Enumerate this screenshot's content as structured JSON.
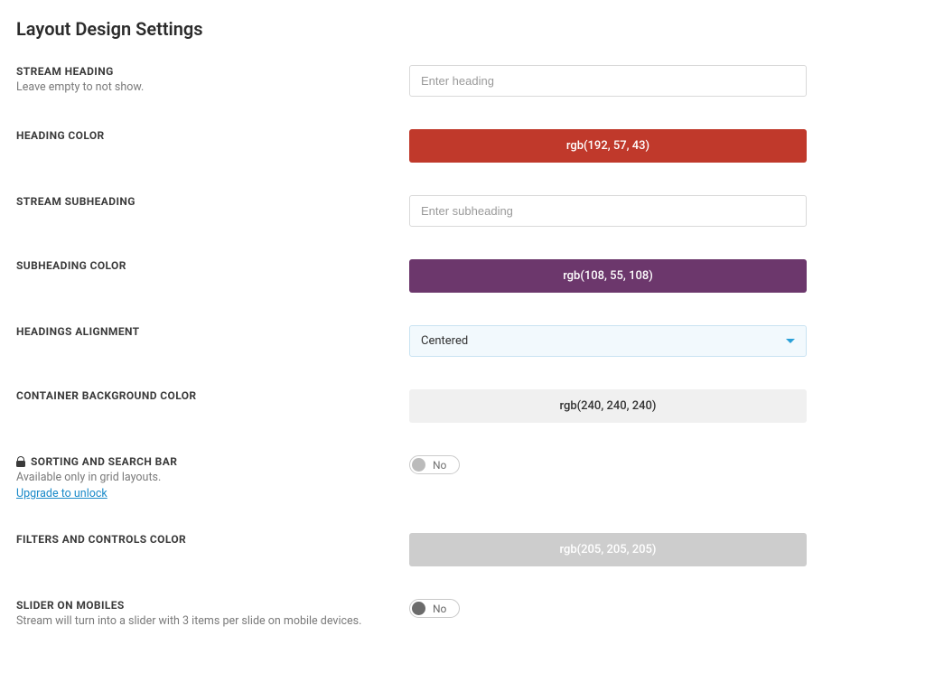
{
  "page": {
    "title": "Layout Design Settings"
  },
  "settings": {
    "stream_heading": {
      "label": "STREAM HEADING",
      "hint": "Leave empty to not show.",
      "placeholder": "Enter heading",
      "value": ""
    },
    "heading_color": {
      "label": "HEADING COLOR",
      "value_text": "rgb(192, 57, 43)",
      "value_hex": "#c0392b"
    },
    "stream_subheading": {
      "label": "STREAM SUBHEADING",
      "placeholder": "Enter subheading",
      "value": ""
    },
    "subheading_color": {
      "label": "SUBHEADING COLOR",
      "value_text": "rgb(108, 55, 108)",
      "value_hex": "#6c376c"
    },
    "headings_alignment": {
      "label": "HEADINGS ALIGNMENT",
      "selected": "Centered"
    },
    "container_bg_color": {
      "label": "CONTAINER BACKGROUND COLOR",
      "value_text": "rgb(240, 240, 240)",
      "value_hex": "#f0f0f0"
    },
    "sorting_search": {
      "label": "SORTING AND SEARCH BAR",
      "hint": "Available only in grid layouts.",
      "upgrade_text": "Upgrade to unlock",
      "toggle_label": "No",
      "locked": true
    },
    "filters_controls_color": {
      "label": "FILTERS AND CONTROLS COLOR",
      "value_text": "rgb(205, 205, 205)",
      "value_hex": "#cdcdcd"
    },
    "slider_mobiles": {
      "label": "SLIDER ON MOBILES",
      "hint": "Stream will turn into a slider with 3 items per slide on mobile devices.",
      "toggle_label": "No"
    }
  }
}
